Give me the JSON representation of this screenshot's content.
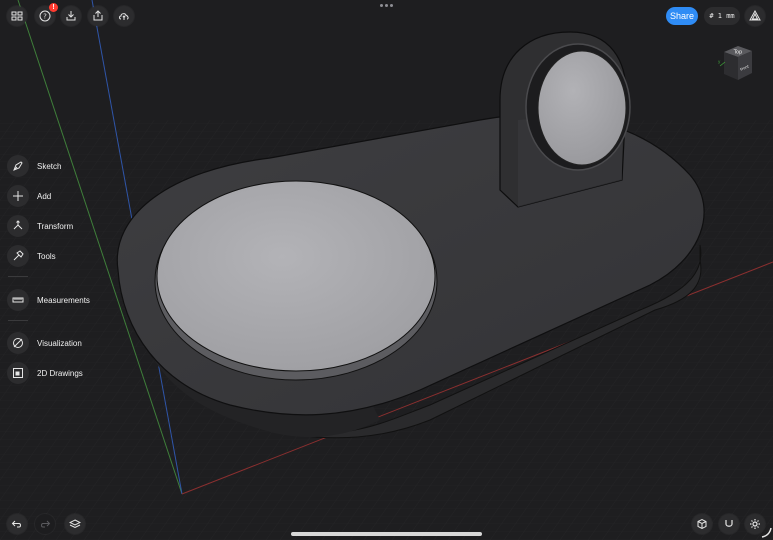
{
  "toolbar": {
    "help_badge": "!",
    "share_label": "Share",
    "grid_size": "# 1 mm"
  },
  "viewcube": {
    "front_label": "Top",
    "side_label": "Front"
  },
  "tools": [
    {
      "label": "Sketch",
      "icon": "pen-nib-icon"
    },
    {
      "label": "Add",
      "icon": "plus-icon"
    },
    {
      "label": "Transform",
      "icon": "transform-icon"
    },
    {
      "label": "Tools",
      "icon": "hammer-icon"
    },
    {
      "label": "Measurements",
      "icon": "ruler-icon"
    },
    {
      "label": "Visualization",
      "icon": "visualization-icon"
    },
    {
      "label": "2D Drawings",
      "icon": "drawing-sheet-icon"
    }
  ],
  "colors": {
    "background": "#1d1d1f",
    "accent": "#2f8cf5",
    "body_dark": "#3a3a3c",
    "disc": "#a9a9ad"
  }
}
